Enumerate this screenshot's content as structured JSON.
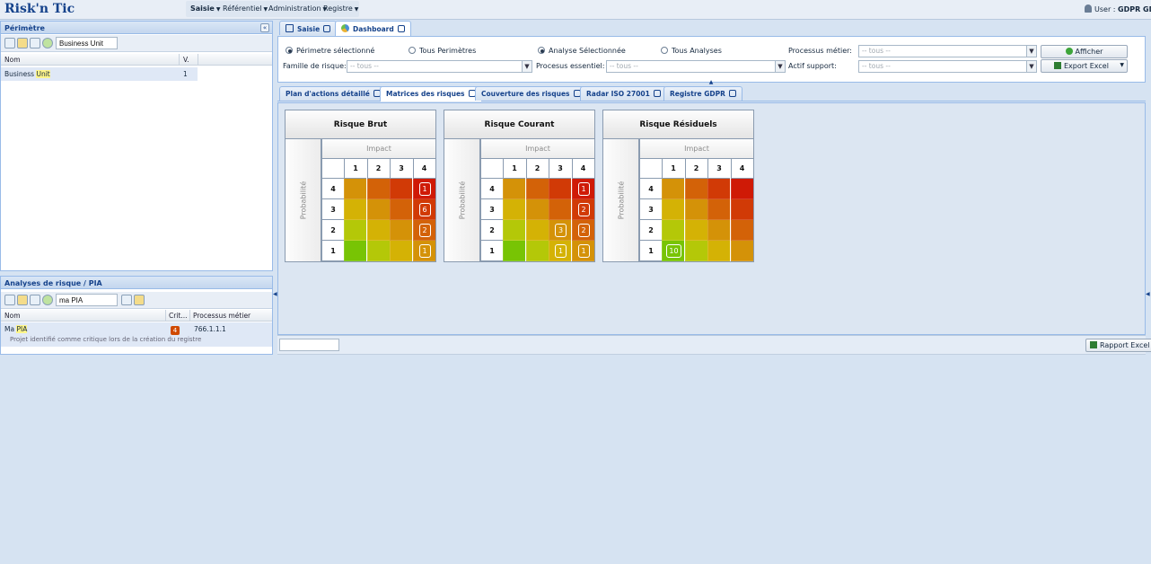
{
  "app": {
    "title": "Risk'n Tic"
  },
  "menu": [
    {
      "label": "Saisie",
      "bold": true
    },
    {
      "label": "Référentiel",
      "bold": false
    },
    {
      "label": "Administration",
      "bold": false
    },
    {
      "label": "Registre",
      "bold": false
    }
  ],
  "user": {
    "prefix": "User : ",
    "name": "GDPR GDF"
  },
  "perimetre": {
    "title": "Périmètre",
    "search_value": "Business Unit",
    "columns": [
      "Nom",
      "V."
    ],
    "rows": [
      {
        "name_pre": "Business ",
        "name_hl": "Unit",
        "v": "1"
      }
    ]
  },
  "analyses": {
    "title": "Analyses de risque / PIA",
    "search_value": "ma PIA",
    "columns": [
      "Nom",
      "Crit...",
      "Processus métier"
    ],
    "rows": [
      {
        "name_pre": "Ma ",
        "name_hl": "PIA",
        "crit": "4",
        "processus": "766.1.1.1",
        "desc": "Projet identifié comme critique lors de la création du registre"
      }
    ]
  },
  "main_tabs": [
    {
      "label": "Saisie",
      "active": false
    },
    {
      "label": "Dashboard",
      "active": true
    }
  ],
  "filters": {
    "radios": [
      {
        "label": "Périmetre sélectionné",
        "checked": true
      },
      {
        "label": "Tous Perimètres",
        "checked": false
      },
      {
        "label": "Analyse Sélectionnée",
        "checked": true
      },
      {
        "label": "Tous Analyses",
        "checked": false
      }
    ],
    "processus_metier_label": "Processus métier:",
    "famille_label": "Famille de risque:",
    "processus_essentiel_label": "Procesus essentiel:",
    "actif_label": "Actif support:",
    "placeholder": "-- tous --",
    "afficher_label": "Afficher",
    "export_label": "Export Excel"
  },
  "sub_tabs": [
    {
      "label": "Plan d'actions détaillé",
      "active": false
    },
    {
      "label": "Matrices des risques",
      "active": true
    },
    {
      "label": "Couverture des risques",
      "active": false
    },
    {
      "label": "Radar ISO 27001",
      "active": false
    },
    {
      "label": "Registre GDPR",
      "active": false
    }
  ],
  "matrices": [
    {
      "title": "Risque Brut",
      "impact_label": "Impact",
      "prob_label": "Probabilité",
      "cols": [
        "1",
        "2",
        "3",
        "4"
      ],
      "rows": [
        "4",
        "3",
        "2",
        "1"
      ],
      "cells": [
        [
          {
            "c": "#d49208"
          },
          {
            "c": "#d36208"
          },
          {
            "c": "#d13a06"
          },
          {
            "c": "#cf1a06",
            "v": "1"
          }
        ],
        [
          {
            "c": "#d4b205"
          },
          {
            "c": "#d49208"
          },
          {
            "c": "#d36208"
          },
          {
            "c": "#d13a06",
            "v": "6"
          }
        ],
        [
          {
            "c": "#b4c808"
          },
          {
            "c": "#d4b205"
          },
          {
            "c": "#d49208"
          },
          {
            "c": "#d36208",
            "v": "2"
          }
        ],
        [
          {
            "c": "#78c404"
          },
          {
            "c": "#b4c808"
          },
          {
            "c": "#d4b205"
          },
          {
            "c": "#d49208",
            "v": "1"
          }
        ]
      ]
    },
    {
      "title": "Risque Courant",
      "impact_label": "Impact",
      "prob_label": "Probabilité",
      "cols": [
        "1",
        "2",
        "3",
        "4"
      ],
      "rows": [
        "4",
        "3",
        "2",
        "1"
      ],
      "cells": [
        [
          {
            "c": "#d49208"
          },
          {
            "c": "#d36208"
          },
          {
            "c": "#d13a06"
          },
          {
            "c": "#cf1a06",
            "v": "1"
          }
        ],
        [
          {
            "c": "#d4b205"
          },
          {
            "c": "#d49208"
          },
          {
            "c": "#d36208"
          },
          {
            "c": "#d13a06",
            "v": "2"
          }
        ],
        [
          {
            "c": "#b4c808"
          },
          {
            "c": "#d4b205"
          },
          {
            "c": "#d49208",
            "v": "3"
          },
          {
            "c": "#d36208",
            "v": "2"
          }
        ],
        [
          {
            "c": "#78c404"
          },
          {
            "c": "#b4c808"
          },
          {
            "c": "#d4b205",
            "v": "1"
          },
          {
            "c": "#d49208",
            "v": "1"
          }
        ]
      ]
    },
    {
      "title": "Risque Résiduels",
      "impact_label": "Impact",
      "prob_label": "Probabilité",
      "cols": [
        "1",
        "2",
        "3",
        "4"
      ],
      "rows": [
        "4",
        "3",
        "2",
        "1"
      ],
      "cells": [
        [
          {
            "c": "#d49208"
          },
          {
            "c": "#d36208"
          },
          {
            "c": "#d13a06"
          },
          {
            "c": "#cf1a06"
          }
        ],
        [
          {
            "c": "#d4b205"
          },
          {
            "c": "#d49208"
          },
          {
            "c": "#d36208"
          },
          {
            "c": "#d13a06"
          }
        ],
        [
          {
            "c": "#b4c808"
          },
          {
            "c": "#d4b205"
          },
          {
            "c": "#d49208"
          },
          {
            "c": "#d36208"
          }
        ],
        [
          {
            "c": "#78c404",
            "v": "10"
          },
          {
            "c": "#b4c808"
          },
          {
            "c": "#d4b205"
          },
          {
            "c": "#d49208"
          }
        ]
      ]
    }
  ],
  "bottom": {
    "rapport_label": "Rapport Excel"
  }
}
